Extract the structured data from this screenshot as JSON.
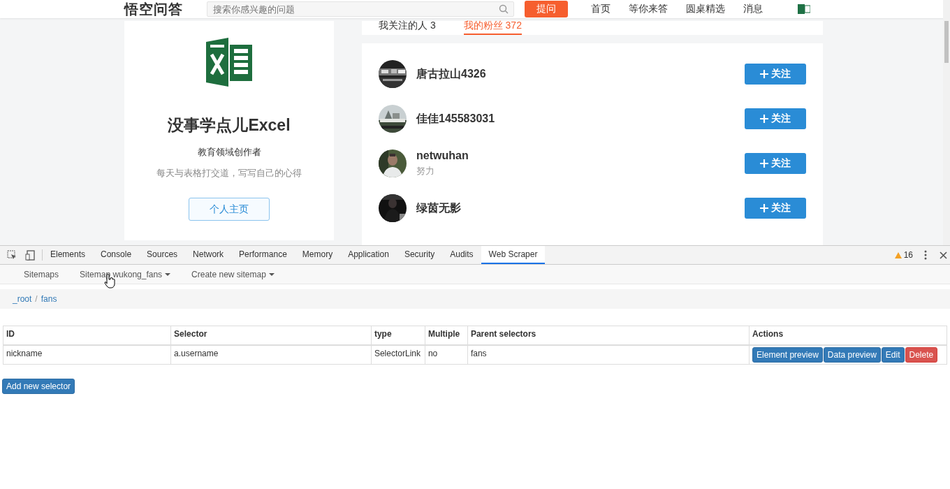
{
  "site_header": {
    "logo": "悟空问答",
    "search": {
      "placeholder": "搜索你感兴趣的问题"
    },
    "ask_button": "提问",
    "nav": [
      "首页",
      "等你来答",
      "圆桌精选",
      "消息"
    ]
  },
  "profile": {
    "name": "没事学点儿Excel",
    "role": "教育领域创作者",
    "bio": "每天与表格打交道，写写自己的心得",
    "home_button": "个人主页"
  },
  "tabs": [
    {
      "label": "我关注的人 3",
      "selected": false
    },
    {
      "label": "我的粉丝 372",
      "selected": true
    }
  ],
  "fans": [
    {
      "name": "唐古拉山4326",
      "follow_button": "关注"
    },
    {
      "name": "佳佳145583031",
      "follow_button": "关注"
    },
    {
      "name": "netwuhan",
      "note": "努力",
      "follow_button": "关注"
    },
    {
      "name": "绿茵无影",
      "follow_button": "关注"
    }
  ],
  "devtools": {
    "tabs": [
      {
        "label": "Elements",
        "selected": false
      },
      {
        "label": "Console",
        "selected": false
      },
      {
        "label": "Sources",
        "selected": false
      },
      {
        "label": "Network",
        "selected": false
      },
      {
        "label": "Performance",
        "selected": false
      },
      {
        "label": "Memory",
        "selected": false
      },
      {
        "label": "Application",
        "selected": false
      },
      {
        "label": "Security",
        "selected": false
      },
      {
        "label": "Audits",
        "selected": false
      },
      {
        "label": "Web Scraper",
        "selected": true
      }
    ],
    "warning_count": "16"
  },
  "scraper": {
    "nav": [
      {
        "label": "Sitemaps",
        "dropdown": false
      },
      {
        "label": "Sitemap wukong_fans",
        "dropdown": true
      },
      {
        "label": "Create new sitemap",
        "dropdown": true
      }
    ],
    "breadcrumb": {
      "items": [
        "_root",
        "fans"
      ],
      "separator": "/"
    },
    "table": {
      "columns": [
        "ID",
        "Selector",
        "type",
        "Multiple",
        "Parent selectors",
        "Actions"
      ],
      "rows": [
        {
          "cells": [
            "nickname",
            "a.username",
            "SelectorLink",
            "no",
            "fans"
          ],
          "actions": [
            {
              "label": "Element preview",
              "kind": "primary"
            },
            {
              "label": "Data preview",
              "kind": "primary"
            },
            {
              "label": "Edit",
              "kind": "primary"
            },
            {
              "label": "Delete",
              "kind": "danger"
            }
          ]
        }
      ]
    },
    "add_button": "Add new selector"
  }
}
